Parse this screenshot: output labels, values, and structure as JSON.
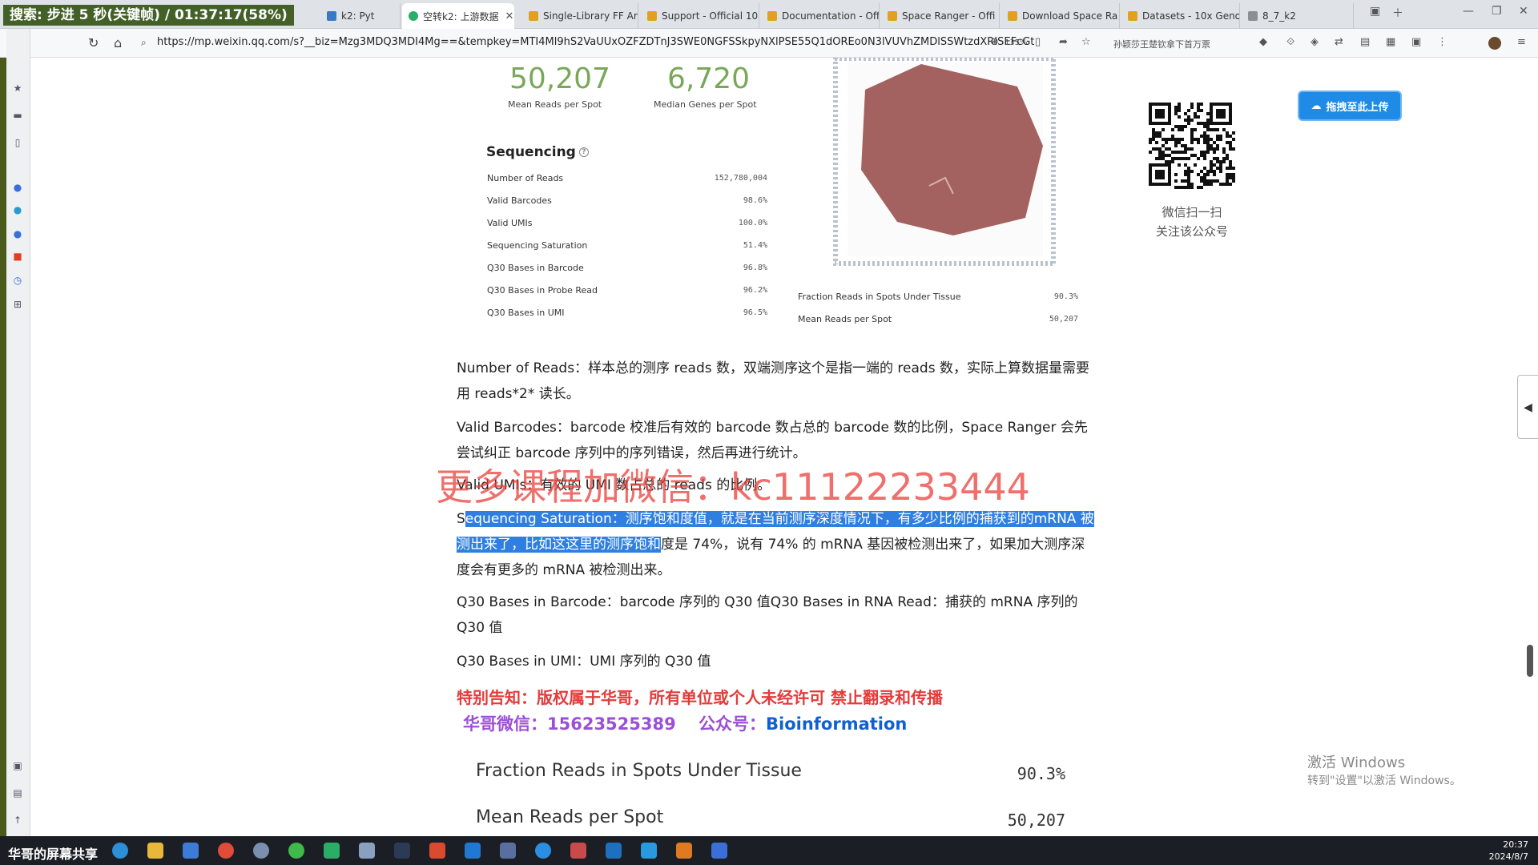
{
  "overlay_text": "搜索: 步进 5 秒(关键帧) / 01:37:17(58%)",
  "tabs": [
    {
      "label": "k2: Pyt",
      "icon": "python-icon",
      "active": false
    },
    {
      "label": "空转k2: 上游数据",
      "icon": "wechat-icon",
      "active": true
    },
    {
      "label": "Single-Library FF Ar",
      "icon": "10x-icon",
      "active": false
    },
    {
      "label": "Support - Official 10",
      "icon": "10x-icon",
      "active": false
    },
    {
      "label": "Documentation - Off",
      "icon": "10x-icon",
      "active": false
    },
    {
      "label": "Space Ranger - Offi",
      "icon": "10x-icon",
      "active": false
    },
    {
      "label": "Download Space Ra",
      "icon": "10x-icon",
      "active": false
    },
    {
      "label": "Datasets - 10x Geno",
      "icon": "10x-icon",
      "active": false
    },
    {
      "label": "8_7_k2",
      "icon": "question-icon",
      "active": false
    }
  ],
  "address": {
    "url": "https://mp.weixin.qq.com/s?__biz=Mzg3MDQ3MDI4Mg==&tempkey=MTI4Ml9hS2VaUUxOZFZDTnJ3SWE0NGFSSkpyNXlPSE55Q1dOREo0N3lVUVhZMDlSSWtzdXRISEFcGt",
    "zoom": "135%",
    "search_hint": "孙颖莎王楚钦拿下首万票"
  },
  "metrics": [
    {
      "value": "50,207",
      "label": "Mean Reads per Spot"
    },
    {
      "value": "6,720",
      "label": "Median Genes per Spot"
    }
  ],
  "sequencing": {
    "title": "Sequencing",
    "rows": [
      {
        "label": "Number of Reads",
        "value": "152,780,004"
      },
      {
        "label": "Valid Barcodes",
        "value": "98.6%"
      },
      {
        "label": "Valid UMIs",
        "value": "100.0%"
      },
      {
        "label": "Sequencing Saturation",
        "value": "51.4%"
      },
      {
        "label": "Q30 Bases in Barcode",
        "value": "96.8%"
      },
      {
        "label": "Q30 Bases in Probe Read",
        "value": "96.2%"
      },
      {
        "label": "Q30 Bases in UMI",
        "value": "96.5%"
      }
    ]
  },
  "tissue_stats": [
    {
      "label": "Fraction Reads in Spots Under Tissue",
      "value": "90.3%"
    },
    {
      "label": "Mean Reads per Spot",
      "value": "50,207"
    }
  ],
  "qr": {
    "line1": "微信扫一扫",
    "line2": "关注该公众号"
  },
  "upload_button": "拖拽至此上传",
  "paragraphs": {
    "p1": "Number of Reads：样本总的测序 reads 数，双端测序这个是指一端的 reads 数，实际上算数据量需要用 reads*2* 读长。",
    "p2": "Valid Barcodes：barcode 校准后有效的 barcode 数占总的 barcode 数的比例，Space Ranger 会先尝试纠正 barcode 序列中的序列错误，然后再进行统计。",
    "p3": "Valid UMIs：有效的 UMI 数占总的 reads 的比例。",
    "p4_pre": "S",
    "p4_hl": "equencing Saturation：测序饱和度值，就是在当前测序深度情况下，有多少比例的捕获到的mRNA 被测出来了，比如这这里的测序饱和",
    "p4_post": "度是 74%，说有 74% 的 mRNA 基因被检测出来了，如果加大测序深度会有更多的 mRNA 被检测出来。",
    "p5": "Q30 Bases in Barcode：barcode 序列的 Q30 值Q30 Bases in RNA Read：捕获的 mRNA 序列的 Q30 值",
    "p6": "Q30 Bases in UMI：UMI 序列的 Q30 值"
  },
  "watermark": "更多课程加微信：kc11122233444",
  "notice": "特别告知：版权属于华哥，所有单位或个人未经许可 禁止翻录和传播",
  "contact": {
    "wechat_label": "华哥微信：",
    "wechat_value": "15623525389",
    "gzh_label": "公众号：",
    "gzh_value": "Bioinformation"
  },
  "big_rows": [
    {
      "label": "Fraction Reads in Spots Under Tissue",
      "value": "90.3%"
    },
    {
      "label": "Mean Reads per Spot",
      "value": "50,207"
    }
  ],
  "activate": {
    "line1": "激活 Windows",
    "line2": "转到\"设置\"以激活 Windows。"
  },
  "taskbar": {
    "label": "华哥的屏幕共享",
    "time": "20:37",
    "date": "2024/8/7"
  },
  "colors": {
    "metric_green": "#7aa85a",
    "highlight_blue": "#2f7fe0",
    "notice_red": "#e53a3a",
    "wechat_purple": "#9b4fd6",
    "gzh_blue": "#1060d0"
  }
}
